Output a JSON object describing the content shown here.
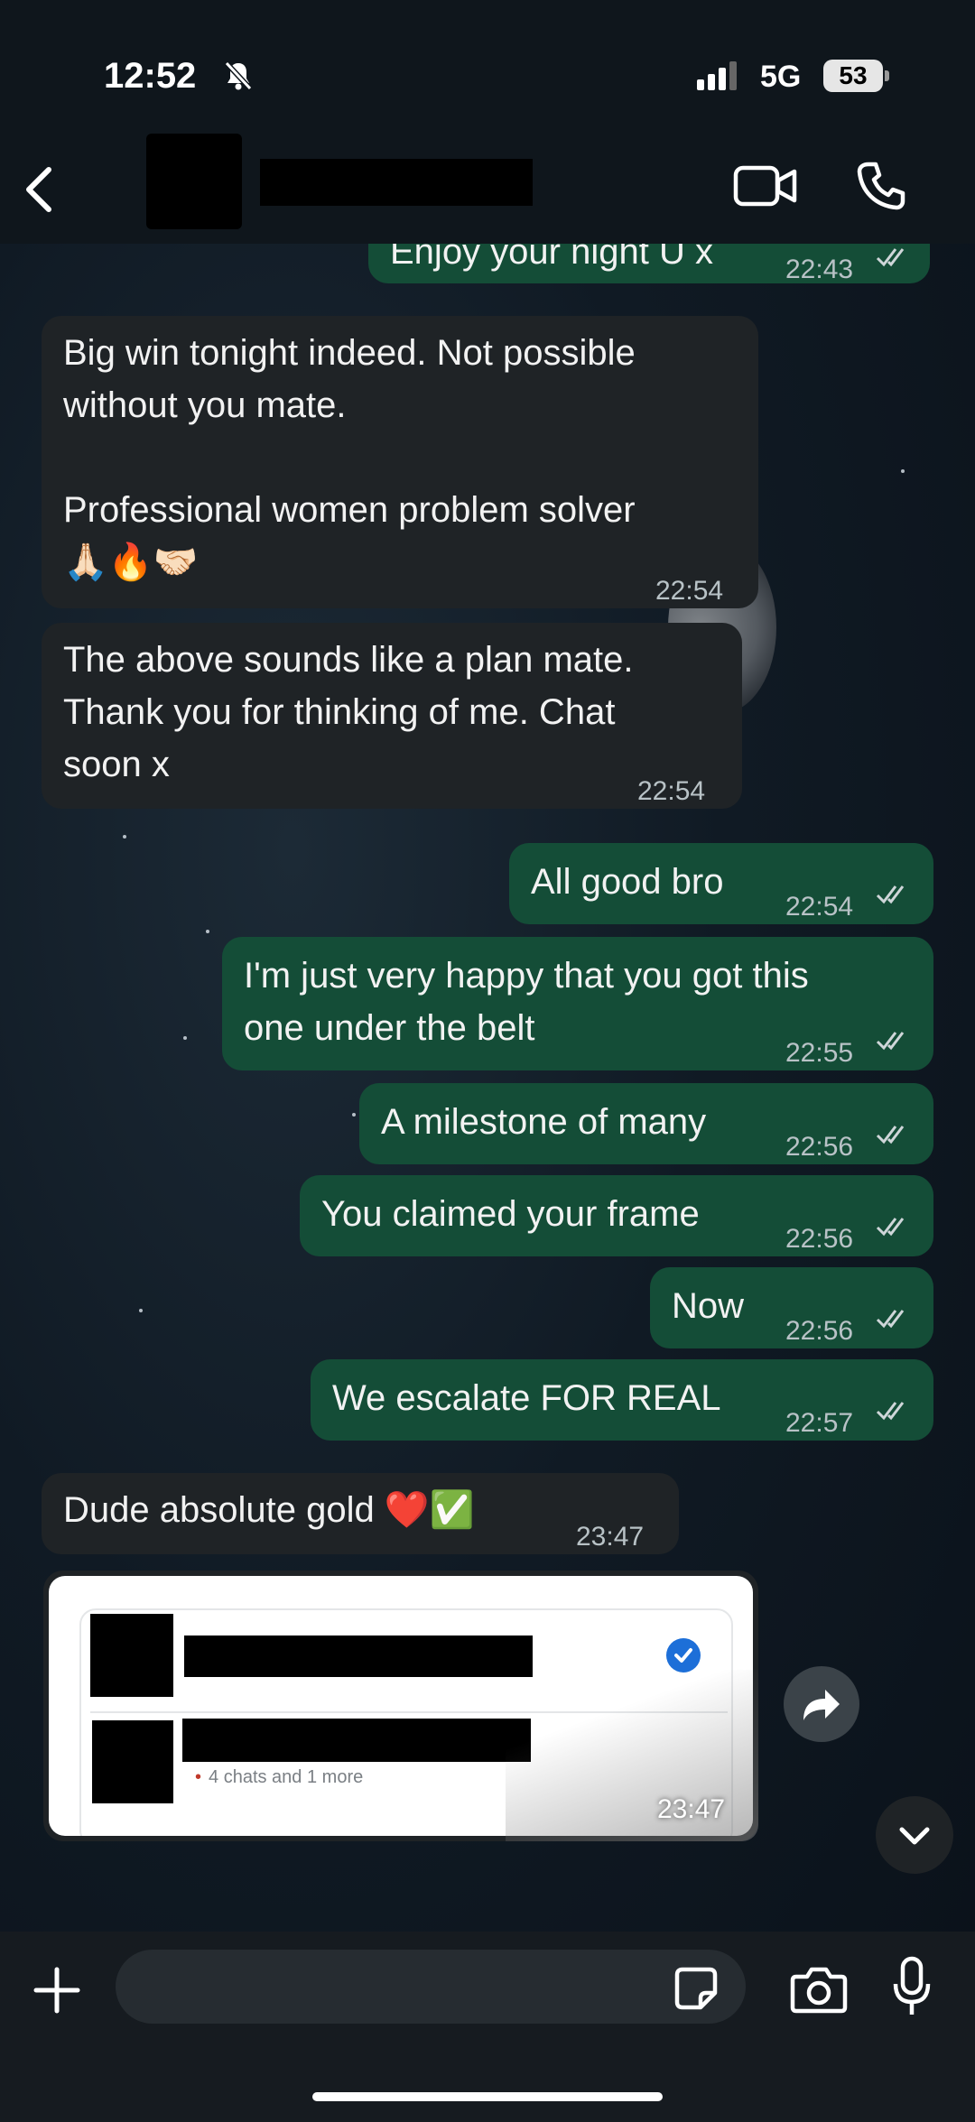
{
  "status": {
    "time": "12:52",
    "network": "5G",
    "battery": "53"
  },
  "header": {
    "back": "back",
    "avatar": "redacted",
    "name": "redacted"
  },
  "messages": [
    {
      "dir": "out",
      "text": "Enjoy your night U x",
      "time": "22:43",
      "read": true
    },
    {
      "dir": "in",
      "text": "Big win tonight indeed. Not possible\nwithout you mate.\n\nProfessional women problem solver\n🙏🏻🔥🤝🏻",
      "time": "22:54"
    },
    {
      "dir": "in",
      "text": "The above sounds like a plan mate.\nThank you for thinking of me. Chat\nsoon x",
      "time": "22:54"
    },
    {
      "dir": "out",
      "text": "All good bro",
      "time": "22:54",
      "read": true
    },
    {
      "dir": "out",
      "text": "I'm just very happy that you got this\none under the belt",
      "time": "22:55",
      "read": true
    },
    {
      "dir": "out",
      "text": "A milestone of many",
      "time": "22:56",
      "read": true
    },
    {
      "dir": "out",
      "text": "You claimed your frame",
      "time": "22:56",
      "read": true
    },
    {
      "dir": "out",
      "text": "Now",
      "time": "22:56",
      "read": true
    },
    {
      "dir": "out",
      "text": "We escalate FOR REAL",
      "time": "22:57",
      "read": true
    },
    {
      "dir": "in",
      "text": "Dude absolute gold ❤️✅",
      "time": "23:47"
    }
  ],
  "card": {
    "meta": "4 chats and 1 more",
    "time": "23:47"
  },
  "icons": [
    "bell-slash-icon",
    "signal-icon",
    "back-icon",
    "video-call-icon",
    "phone-icon",
    "forward-icon",
    "chevron-down-icon",
    "plus-icon",
    "sticker-icon",
    "camera-icon",
    "mic-icon",
    "double-check-icon",
    "verified-icon"
  ]
}
